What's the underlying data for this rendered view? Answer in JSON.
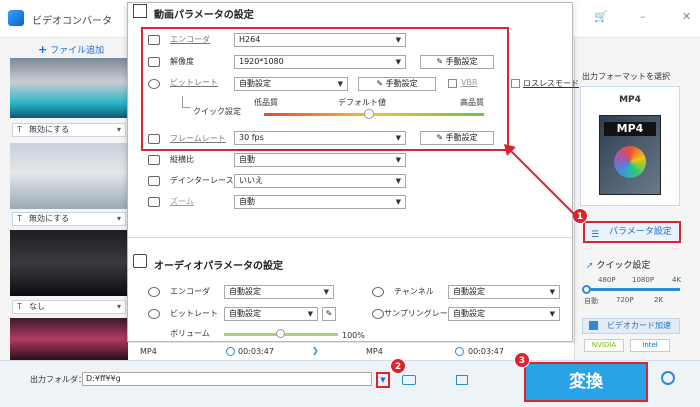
{
  "window": {
    "title": "ビデオコンバータ",
    "min": "–",
    "max": "□",
    "close": "✕"
  },
  "left": {
    "add_file": "ファイル追加",
    "subtitle_items": [
      "無効にする",
      "無効にする",
      "なし"
    ]
  },
  "video_params": {
    "title": "動画パラメータの設定",
    "encoder_label": "エンコーダ",
    "encoder_value": "H264",
    "resolution_label": "解像度",
    "resolution_value": "1920*1080",
    "bitrate_label": "ビットレート",
    "bitrate_value": "自動設定",
    "vbr_label": "VBR",
    "quick_label": "クイック設定",
    "quick_low": "低品質",
    "quick_default": "デフォルト値",
    "quick_high": "高品質",
    "framerate_label": "フレームレート",
    "framerate_value": "30 fps",
    "aspect_label": "縦横比",
    "aspect_value": "自動",
    "deinterlace_label": "デインターレース",
    "deinterlace_value": "いいえ",
    "zoom_label": "ズーム",
    "zoom_value": "自動",
    "manual_btn": "手動設定",
    "lossless_label": "ロスレスモード",
    "quick_level": 0.5
  },
  "audio_params": {
    "title": "オーディオパラメータの設定",
    "encoder_label": "エンコーダ",
    "encoder_value": "自動設定",
    "bitrate_label": "ビットレート",
    "bitrate_value": "自動設定",
    "volume_label": "ボリューム",
    "volume_value": "100%",
    "channel_label": "チャンネル",
    "channel_value": "自動設定",
    "samplerate_label": "サンプリングレート",
    "samplerate_value": "自動設定",
    "volume_level": 0.5
  },
  "strip": {
    "fmt1": "MP4",
    "time1": "00:03:47",
    "fmt2": "MP4",
    "time2": "00:03:47"
  },
  "right": {
    "output_format_label": "出力フォーマットを選択",
    "format": "MP4",
    "param_btn": "パラメータ設定",
    "quick_title": "クイック設定",
    "quick_top": [
      "480P",
      "1080P",
      "4K"
    ],
    "quick_bottom": [
      "自動",
      "720P",
      "2K"
    ],
    "gpu_btn": "ビデオカード加速",
    "gpu_brands": [
      "NVIDIA",
      "Intel"
    ]
  },
  "bottom": {
    "out_folder_label": "出力フォルダ：",
    "out_path": "D:¥ff¥¥g",
    "convert": "変換"
  },
  "badges": [
    "1",
    "2",
    "3"
  ],
  "colors": {
    "accent_red": "#d9262e",
    "convert_blue": "#29a3e8",
    "link_blue": "#1a6fd0"
  }
}
